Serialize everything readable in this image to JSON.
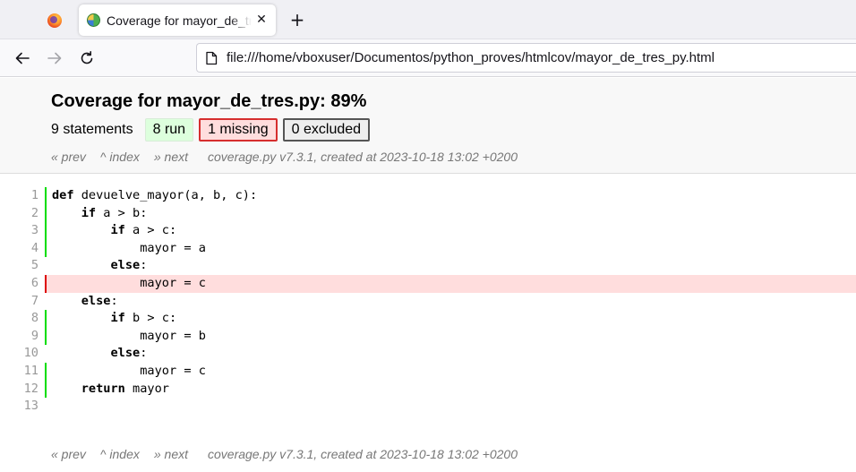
{
  "browser": {
    "active_tab_title": "Coverage for mayor_de_tres.py: 89%",
    "url": "file:///home/vboxuser/Documentos/python_proves/htmlcov/mayor_de_tres_py.html"
  },
  "report": {
    "title_prefix": "Coverage for ",
    "file_name": "mayor_de_tres.py",
    "title_suffix": ": 89%",
    "statements": "9 statements",
    "run": "8 run",
    "missing": "1 missing",
    "excluded": "0 excluded",
    "nav": {
      "prev": "« prev",
      "index": "^ index",
      "next": "» next",
      "created": "coverage.py v7.3.1, created at 2023-10-18 13:02 +0200"
    }
  },
  "colors": {
    "run_marker": "#00dd00",
    "missing_marker": "#dd0000",
    "missing_background": "#ffdddd"
  },
  "source_lines": [
    {
      "n": "1",
      "status": "run",
      "indent": "",
      "kw": "def",
      "rest": " devuelve_mayor(a, b, c):"
    },
    {
      "n": "2",
      "status": "run",
      "indent": "    ",
      "kw": "if",
      "rest": " a > b:"
    },
    {
      "n": "3",
      "status": "run",
      "indent": "        ",
      "kw": "if",
      "rest": " a > c:"
    },
    {
      "n": "4",
      "status": "run",
      "indent": "            ",
      "kw": "",
      "rest": "mayor = a"
    },
    {
      "n": "5",
      "status": "",
      "indent": "        ",
      "kw": "else",
      "rest": ":"
    },
    {
      "n": "6",
      "status": "mis",
      "indent": "            ",
      "kw": "",
      "rest": "mayor = c"
    },
    {
      "n": "7",
      "status": "",
      "indent": "    ",
      "kw": "else",
      "rest": ":"
    },
    {
      "n": "8",
      "status": "run",
      "indent": "        ",
      "kw": "if",
      "rest": " b > c:"
    },
    {
      "n": "9",
      "status": "run",
      "indent": "            ",
      "kw": "",
      "rest": "mayor = b"
    },
    {
      "n": "10",
      "status": "",
      "indent": "        ",
      "kw": "else",
      "rest": ":"
    },
    {
      "n": "11",
      "status": "run",
      "indent": "            ",
      "kw": "",
      "rest": "mayor = c"
    },
    {
      "n": "12",
      "status": "run",
      "indent": "    ",
      "kw": "return",
      "rest": " mayor"
    },
    {
      "n": "13",
      "status": "",
      "indent": "",
      "kw": "",
      "rest": ""
    }
  ]
}
